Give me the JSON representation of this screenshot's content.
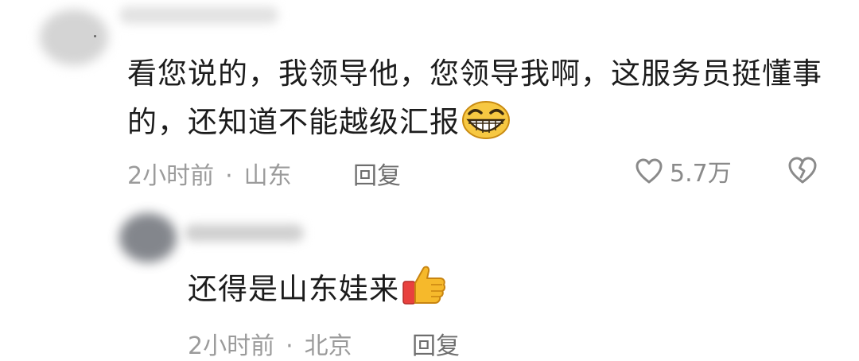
{
  "comments": [
    {
      "text": "看您说的，我领导他，您领导我啊，这服务员挺懂事的，还知道不能越级汇报",
      "emoji": "grinning-face-emoji",
      "time": "2小时前",
      "separator": "·",
      "location": "山东",
      "reply_label": "回复",
      "like_count": "5.7万",
      "like_icon": "heart-outline-icon",
      "dislike_icon": "broken-heart-icon"
    },
    {
      "text": "还得是山东娃来",
      "emoji": "thumbs-up-emoji",
      "time": "2小时前",
      "separator": "·",
      "location": "北京",
      "reply_label": "回复"
    }
  ],
  "colors": {
    "text": "#1c1c1c",
    "meta": "#9b9b9b",
    "background": "#ffffff"
  }
}
